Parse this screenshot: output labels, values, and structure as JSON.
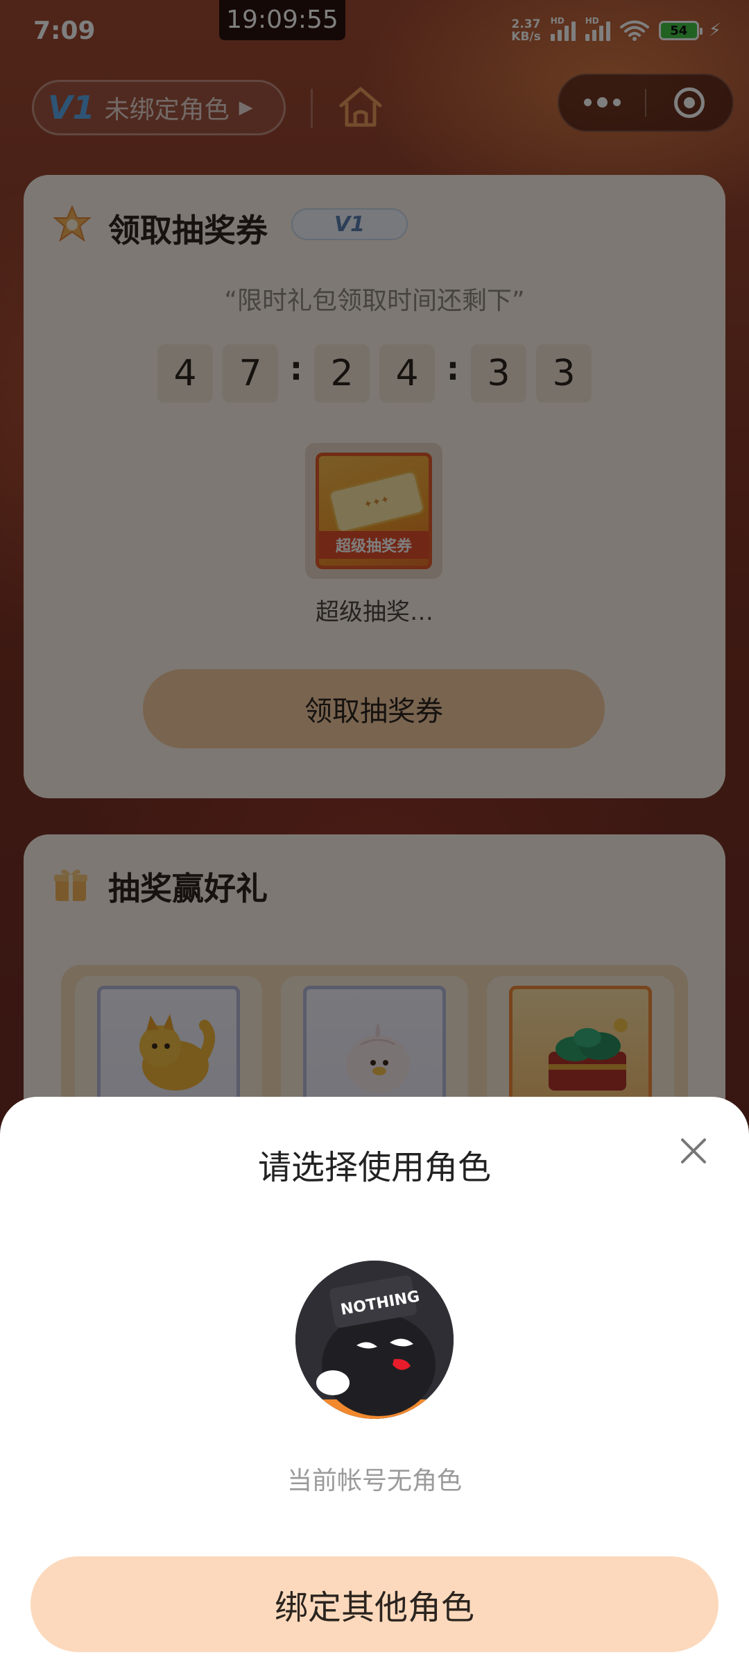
{
  "status_bar": {
    "time": "7:09",
    "clock_overlay": "19:09:55",
    "net_speed_value": "2.37",
    "net_speed_unit": "KB/s",
    "signal_badge_1": "HD",
    "signal_badge_2": "HD",
    "battery_level": "54"
  },
  "top_nav": {
    "role_badge": "V1",
    "role_label": "未绑定角色",
    "role_arrow": "▶",
    "home_icon": "home-icon",
    "capsule_more_icon": "more-dots-icon",
    "capsule_close_icon": "target-icon"
  },
  "claim_card": {
    "title": "领取抽奖券",
    "level_tag": "V1",
    "timer_caption": "“限时礼包领取时间还剩下”",
    "timer_digits": [
      "4",
      "7",
      "2",
      "4",
      "3",
      "3"
    ],
    "timer_separators": [
      ":",
      ":"
    ],
    "prize_ticket_label": "超级抽奖券",
    "prize_name": "超级抽奖…",
    "claim_button": "领取抽奖券"
  },
  "lottery_card": {
    "title": "抽奖赢好礼"
  },
  "sheet": {
    "title": "请选择使用角色",
    "avatar_text": "NOTHING",
    "note": "当前帐号无角色",
    "bind_button": "绑定其他角色"
  },
  "colors": {
    "accent_button": "#fcd9bc",
    "card_bg": "#fbf0e6",
    "battery_green": "#43c447"
  }
}
